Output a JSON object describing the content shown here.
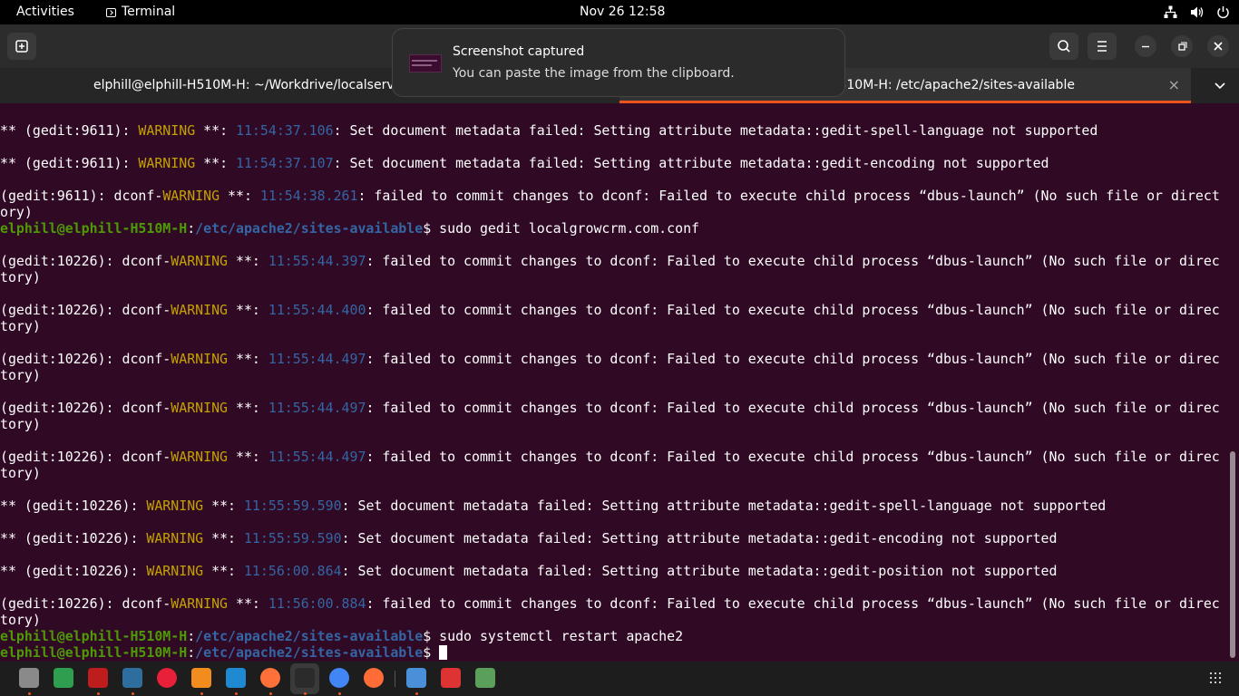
{
  "topbar": {
    "activities": "Activities",
    "app_name": "Terminal",
    "clock": "Nov 26  12:58",
    "icons": [
      "network-icon",
      "volume-icon",
      "power-icon"
    ]
  },
  "tabs": [
    {
      "title": "elphill@elphill-H510M-H: ~/Workdrive/localserver"
    },
    {
      "title": "elphill@elphill-H510M-H: /etc/apache2/sites-available",
      "close": "×"
    }
  ],
  "notification": {
    "title": "Screenshot captured",
    "body": "You can paste the image from the clipboard."
  },
  "terminal": {
    "lines": [
      [
        [
          "** (gedit:9611): ",
          ""
        ],
        [
          "WARNING",
          "w"
        ],
        [
          " **: ",
          ""
        ],
        [
          "11:54:37.106",
          "t"
        ],
        [
          ": Set document metadata failed: Setting attribute metadata::gedit-spell-language not supported",
          ""
        ]
      ],
      [],
      [
        [
          "** (gedit:9611): ",
          ""
        ],
        [
          "WARNING",
          "w"
        ],
        [
          " **: ",
          ""
        ],
        [
          "11:54:37.107",
          "t"
        ],
        [
          ": Set document metadata failed: Setting attribute metadata::gedit-encoding not supported",
          ""
        ]
      ],
      [],
      [
        [
          "(gedit:9611): dconf-",
          ""
        ],
        [
          "WARNING",
          "w"
        ],
        [
          " **: ",
          ""
        ],
        [
          "11:54:38.261",
          "t"
        ],
        [
          ": failed to commit changes to dconf: Failed to execute child process “dbus-launch” (No such file or direct",
          ""
        ]
      ],
      [
        [
          "ory)",
          ""
        ]
      ],
      [
        [
          "elphill@elphill-H510M-H",
          "pu"
        ],
        [
          ":",
          ""
        ],
        [
          "/etc/apache2/sites-available",
          "pp"
        ],
        [
          "$ sudo gedit localgrowcrm.com.conf",
          ""
        ]
      ],
      [],
      [
        [
          "(gedit:10226): dconf-",
          ""
        ],
        [
          "WARNING",
          "w"
        ],
        [
          " **: ",
          ""
        ],
        [
          "11:55:44.397",
          "t"
        ],
        [
          ": failed to commit changes to dconf: Failed to execute child process “dbus-launch” (No such file or direc",
          ""
        ]
      ],
      [
        [
          "tory)",
          ""
        ]
      ],
      [],
      [
        [
          "(gedit:10226): dconf-",
          ""
        ],
        [
          "WARNING",
          "w"
        ],
        [
          " **: ",
          ""
        ],
        [
          "11:55:44.400",
          "t"
        ],
        [
          ": failed to commit changes to dconf: Failed to execute child process “dbus-launch” (No such file or direc",
          ""
        ]
      ],
      [
        [
          "tory)",
          ""
        ]
      ],
      [],
      [
        [
          "(gedit:10226): dconf-",
          ""
        ],
        [
          "WARNING",
          "w"
        ],
        [
          " **: ",
          ""
        ],
        [
          "11:55:44.497",
          "t"
        ],
        [
          ": failed to commit changes to dconf: Failed to execute child process “dbus-launch” (No such file or direc",
          ""
        ]
      ],
      [
        [
          "tory)",
          ""
        ]
      ],
      [],
      [
        [
          "(gedit:10226): dconf-",
          ""
        ],
        [
          "WARNING",
          "w"
        ],
        [
          " **: ",
          ""
        ],
        [
          "11:55:44.497",
          "t"
        ],
        [
          ": failed to commit changes to dconf: Failed to execute child process “dbus-launch” (No such file or direc",
          ""
        ]
      ],
      [
        [
          "tory)",
          ""
        ]
      ],
      [],
      [
        [
          "(gedit:10226): dconf-",
          ""
        ],
        [
          "WARNING",
          "w"
        ],
        [
          " **: ",
          ""
        ],
        [
          "11:55:44.497",
          "t"
        ],
        [
          ": failed to commit changes to dconf: Failed to execute child process “dbus-launch” (No such file or direc",
          ""
        ]
      ],
      [
        [
          "tory)",
          ""
        ]
      ],
      [],
      [
        [
          "** (gedit:10226): ",
          ""
        ],
        [
          "WARNING",
          "w"
        ],
        [
          " **: ",
          ""
        ],
        [
          "11:55:59.590",
          "t"
        ],
        [
          ": Set document metadata failed: Setting attribute metadata::gedit-spell-language not supported",
          ""
        ]
      ],
      [],
      [
        [
          "** (gedit:10226): ",
          ""
        ],
        [
          "WARNING",
          "w"
        ],
        [
          " **: ",
          ""
        ],
        [
          "11:55:59.590",
          "t"
        ],
        [
          ": Set document metadata failed: Setting attribute metadata::gedit-encoding not supported",
          ""
        ]
      ],
      [],
      [
        [
          "** (gedit:10226): ",
          ""
        ],
        [
          "WARNING",
          "w"
        ],
        [
          " **: ",
          ""
        ],
        [
          "11:56:00.864",
          "t"
        ],
        [
          ": Set document metadata failed: Setting attribute metadata::gedit-position not supported",
          ""
        ]
      ],
      [],
      [
        [
          "(gedit:10226): dconf-",
          ""
        ],
        [
          "WARNING",
          "w"
        ],
        [
          " **: ",
          ""
        ],
        [
          "11:56:00.884",
          "t"
        ],
        [
          ": failed to commit changes to dconf: Failed to execute child process “dbus-launch” (No such file or direc",
          ""
        ]
      ],
      [
        [
          "tory)",
          ""
        ]
      ],
      [
        [
          "elphill@elphill-H510M-H",
          "pu"
        ],
        [
          ":",
          ""
        ],
        [
          "/etc/apache2/sites-available",
          "pp"
        ],
        [
          "$ sudo systemctl restart apache2",
          ""
        ]
      ],
      [
        [
          "elphill@elphill-H510M-H",
          "pu"
        ],
        [
          ":",
          ""
        ],
        [
          "/etc/apache2/sites-available",
          "pp"
        ],
        [
          "$ ",
          ""
        ]
      ]
    ]
  },
  "dock": {
    "apps": [
      {
        "name": "files-icon",
        "color": "#8a8a8a",
        "running": true
      },
      {
        "name": "spreadsheet-icon",
        "color": "#2e9e4f",
        "running": false
      },
      {
        "name": "filezilla-icon",
        "color": "#bf1d1d",
        "running": true
      },
      {
        "name": "mysql-workbench-icon",
        "color": "#2d6e9e",
        "running": true
      },
      {
        "name": "video-player-icon",
        "color": "#e8203a",
        "running": false
      },
      {
        "name": "sublime-text-icon",
        "color": "#f28c1f",
        "running": true
      },
      {
        "name": "vscode-icon",
        "color": "#1f8ad2",
        "running": true
      },
      {
        "name": "firefox-icon",
        "color": "#ff7139",
        "running": true
      },
      {
        "name": "terminal-icon",
        "color": "#2b2b2b",
        "running": true
      },
      {
        "name": "chrome-icon",
        "color": "#4285f4",
        "running": true
      },
      {
        "name": "postman-icon",
        "color": "#ff6c37",
        "running": false
      },
      {
        "name": "text-editor-icon",
        "color": "#4a90d9",
        "running": true
      },
      {
        "name": "document-viewer-icon",
        "color": "#d33",
        "running": false
      },
      {
        "name": "trash-icon",
        "color": "#5aa05a",
        "running": false
      }
    ]
  }
}
